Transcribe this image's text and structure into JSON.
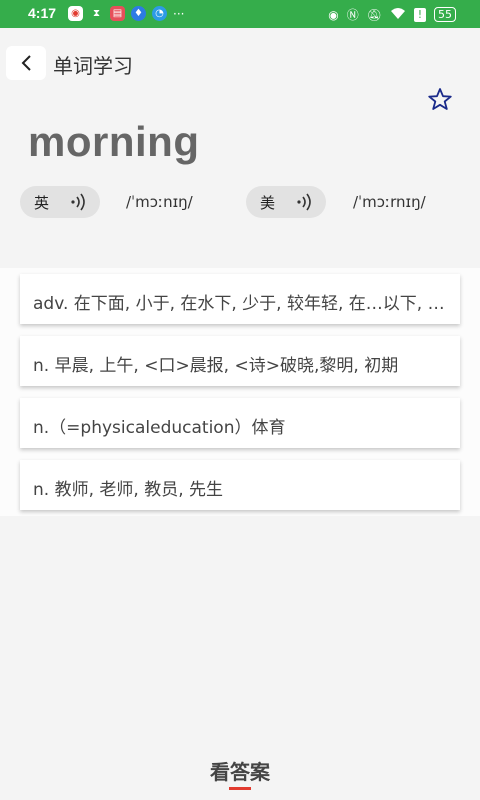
{
  "status_bar": {
    "time": "4:17",
    "more": "···",
    "battery": "55"
  },
  "header": {
    "title": "单词学习"
  },
  "word": "morning",
  "pronunciations": [
    {
      "label": "英",
      "phonetic": "/ˈmɔːnɪŋ/"
    },
    {
      "label": "美",
      "phonetic": "/ˈmɔːrnɪŋ/"
    }
  ],
  "meanings": [
    "adv. 在下面, 小于, 在水下, 少于, 较年轻, 在…以下, 在…下面",
    "n. 早晨, 上午, <口>晨报, <诗>破晓,黎明, 初期",
    "n.（=physicaleducation）体育",
    "n. 教师, 老师, 教员, 先生"
  ],
  "answer_button": "看答案",
  "colors": {
    "status_bar": "#35ad4b",
    "accent_underline": "#e23b2f",
    "star": "#1a2a8a"
  },
  "icons": [
    "back-arrow-icon",
    "star-outline-icon",
    "speaker-icon"
  ]
}
